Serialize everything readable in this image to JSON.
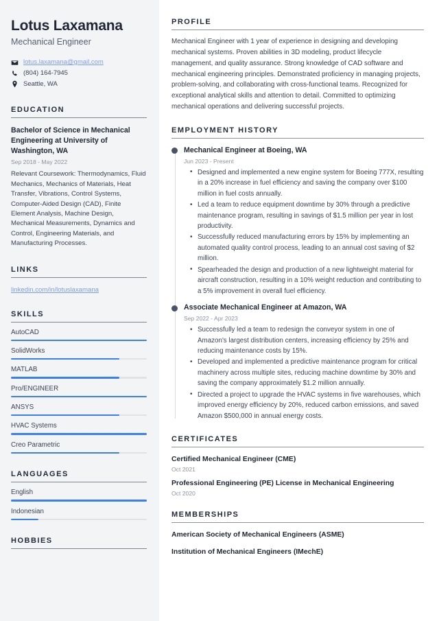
{
  "sidebar": {
    "name": "Lotus Laxamana",
    "job_title": "Mechanical Engineer",
    "contact": [
      {
        "icon": "envelope-icon",
        "value": "lotus.laxamana@gmail.com",
        "is_link": true
      },
      {
        "icon": "phone-icon",
        "value": "(804) 164-7945",
        "is_link": false
      },
      {
        "icon": "map-pin-icon",
        "value": "Seattle, WA",
        "is_link": false
      }
    ],
    "education": {
      "heading": "EDUCATION",
      "degree": "Bachelor of Science in Mechanical Engineering at University of Washington, WA",
      "date": "Sep 2018 - May 2022",
      "description": "Relevant Coursework: Thermodynamics, Fluid Mechanics, Mechanics of Materials, Heat Transfer, Vibrations, Control Systems, Computer-Aided Design (CAD), Finite Element Analysis, Machine Design, Mechanical Measurements, Dynamics and Control, Engineering Materials, and Manufacturing Processes."
    },
    "links": {
      "heading": "LINKS",
      "items": [
        {
          "label": "linkedin.com/in/lotuslaxamana"
        }
      ]
    },
    "skills": {
      "heading": "SKILLS",
      "items": [
        {
          "label": "AutoCAD",
          "level": 100
        },
        {
          "label": "SolidWorks",
          "level": 80
        },
        {
          "label": "MATLAB",
          "level": 80
        },
        {
          "label": "Pro/ENGINEER",
          "level": 100
        },
        {
          "label": "ANSYS",
          "level": 80
        },
        {
          "label": "HVAC Systems",
          "level": 100
        },
        {
          "label": "Creo Parametric",
          "level": 80
        }
      ]
    },
    "languages": {
      "heading": "LANGUAGES",
      "items": [
        {
          "label": "English",
          "level": 100
        },
        {
          "label": "Indonesian",
          "level": 20
        }
      ]
    },
    "hobbies": {
      "heading": "HOBBIES"
    }
  },
  "main": {
    "profile": {
      "heading": "PROFILE",
      "text": "Mechanical Engineer with 1 year of experience in designing and developing mechanical systems. Proven abilities in 3D modeling, product lifecycle management, and quality assurance. Strong knowledge of CAD software and mechanical engineering principles. Demonstrated proficiency in managing projects, problem-solving, and collaborating with cross-functional teams. Recognized for exceptional analytical skills and attention to detail. Committed to optimizing mechanical operations and delivering successful projects."
    },
    "employment": {
      "heading": "EMPLOYMENT HISTORY",
      "jobs": [
        {
          "role": "Mechanical Engineer at Boeing, WA",
          "date": "Jun 2023 - Present",
          "bullets": [
            "Designed and implemented a new engine system for Boeing 777X, resulting in a 20% increase in fuel efficiency and saving the company over $100 million in fuel costs annually.",
            "Led a team to reduce equipment downtime by 30% through a predictive maintenance program, resulting in savings of $1.5 million per year in lost productivity.",
            "Successfully reduced manufacturing errors by 15% by implementing an automated quality control process, leading to an annual cost saving of $2 million.",
            "Spearheaded the design and production of a new lightweight material for aircraft construction, resulting in a 10% weight reduction and contributing to a 5% improvement in overall fuel efficiency."
          ]
        },
        {
          "role": "Associate Mechanical Engineer at Amazon, WA",
          "date": "Sep 2022 - Apr 2023",
          "bullets": [
            "Successfully led a team to redesign the conveyor system in one of Amazon's largest distribution centers, increasing efficiency by 25% and reducing maintenance costs by 15%.",
            "Developed and implemented a predictive maintenance program for critical machinery across multiple sites, reducing machine downtime by 30% and saving the company approximately $1.2 million annually.",
            "Directed a project to upgrade the HVAC systems in five warehouses, which improved energy efficiency by 20%, reduced carbon emissions, and saved Amazon $500,000 in annual energy costs."
          ]
        }
      ]
    },
    "certificates": {
      "heading": "CERTIFICATES",
      "items": [
        {
          "title": "Certified Mechanical Engineer (CME)",
          "date": "Oct 2021"
        },
        {
          "title": "Professional Engineering (PE) License in Mechanical Engineering",
          "date": "Oct 2020"
        }
      ]
    },
    "memberships": {
      "heading": "MEMBERSHIPS",
      "items": [
        {
          "title": "American Society of Mechanical Engineers (ASME)"
        },
        {
          "title": "Institution of Mechanical Engineers (IMechE)"
        }
      ]
    }
  },
  "colors": {
    "accent_blue": "#3b7ef0",
    "link_blue": "#7c9ee6",
    "sidebar_bg": "#f3f4f6",
    "heading_dark": "#222a3a",
    "muted_gray": "#8b919d"
  }
}
